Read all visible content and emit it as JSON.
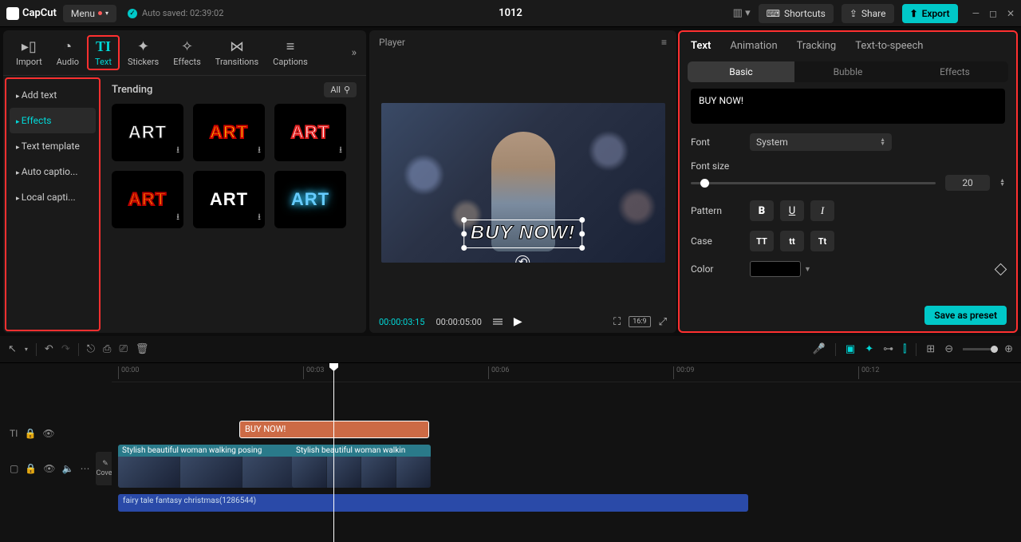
{
  "topbar": {
    "brand": "CapCut",
    "menu": "Menu",
    "autosaved": "Auto saved: 02:39:02",
    "project": "1012",
    "shortcuts": "Shortcuts",
    "share": "Share",
    "export": "Export"
  },
  "tool_tabs": [
    "Import",
    "Audio",
    "Text",
    "Stickers",
    "Effects",
    "Transitions",
    "Captions"
  ],
  "text_sidebar": [
    "Add text",
    "Effects",
    "Text template",
    "Auto captio...",
    "Local capti..."
  ],
  "assets": {
    "heading": "Trending",
    "filter": "All",
    "label": "ART"
  },
  "player": {
    "title": "Player",
    "text_overlay": "BUY NOW!",
    "time_current": "00:00:03:15",
    "time_total": "00:00:05:00",
    "ratio": "16:9"
  },
  "inspector": {
    "tabs": [
      "Text",
      "Animation",
      "Tracking",
      "Text-to-speech"
    ],
    "subtabs": [
      "Basic",
      "Bubble",
      "Effects"
    ],
    "text_value": "BUY NOW!",
    "font_label": "Font",
    "font_value": "System",
    "fontsize_label": "Font size",
    "fontsize_value": "20",
    "pattern_label": "Pattern",
    "case_label": "Case",
    "case_options": [
      "TT",
      "tt",
      "Tt"
    ],
    "color_label": "Color",
    "save_preset": "Save as preset"
  },
  "timeline": {
    "ruler": [
      "00:00",
      "00:03",
      "00:06",
      "00:09",
      "00:12"
    ],
    "text_clip": "BUY NOW!",
    "video_clip1": "Stylish beautiful woman walking posing",
    "video_clip2": "Stylish beautiful woman walkin",
    "audio_clip": "fairy tale fantasy christmas(1286544)",
    "cover": "Cover"
  }
}
